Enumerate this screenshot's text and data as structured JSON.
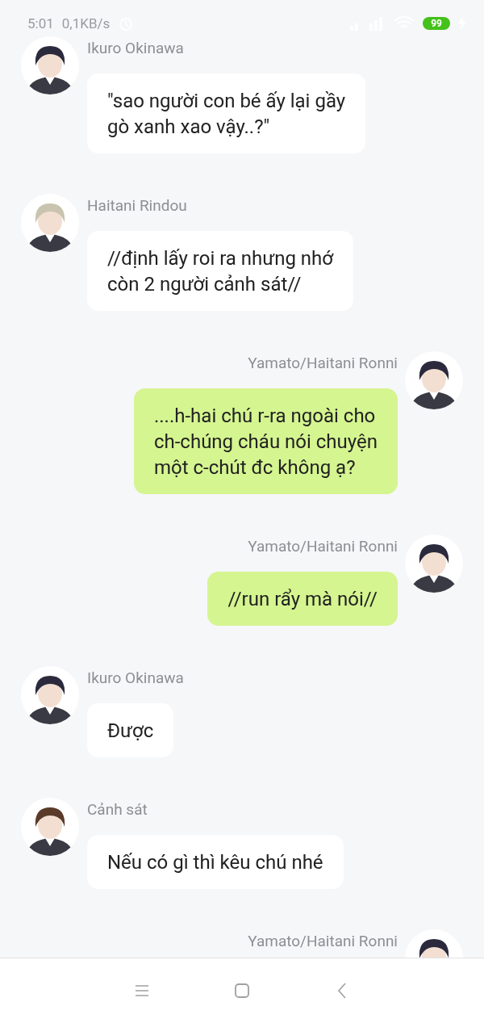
{
  "status_bar": {
    "time": "5:01",
    "speed": "0,1KB/s",
    "battery": "99"
  },
  "messages": [
    {
      "sender": "Ikuro Okinawa",
      "kind": "incoming",
      "text": "\"sao người con bé ấy lại gầy\ngò xanh xao vậy..?\""
    },
    {
      "sender": "Haitani Rindou",
      "kind": "incoming",
      "text": "//định lấy roi ra nhưng nhớ\ncòn 2 người cảnh sát//"
    },
    {
      "sender": "Yamato/Haitani Ronni",
      "kind": "outgoing",
      "text": "....h-hai chú r-ra ngoài cho\nch-chúng cháu nói chuyện\nmột c-chút đc không ạ?"
    },
    {
      "sender": "Yamato/Haitani Ronni",
      "kind": "outgoing",
      "text": "//run rẩy mà nói//"
    },
    {
      "sender": "Ikuro Okinawa",
      "kind": "incoming",
      "text": "Được"
    },
    {
      "sender": "Cảnh sát",
      "kind": "incoming",
      "text": "Nếu có gì thì kêu chú nhé"
    },
    {
      "sender": "Yamato/Haitani Ronni",
      "kind": "outgoing"
    }
  ]
}
